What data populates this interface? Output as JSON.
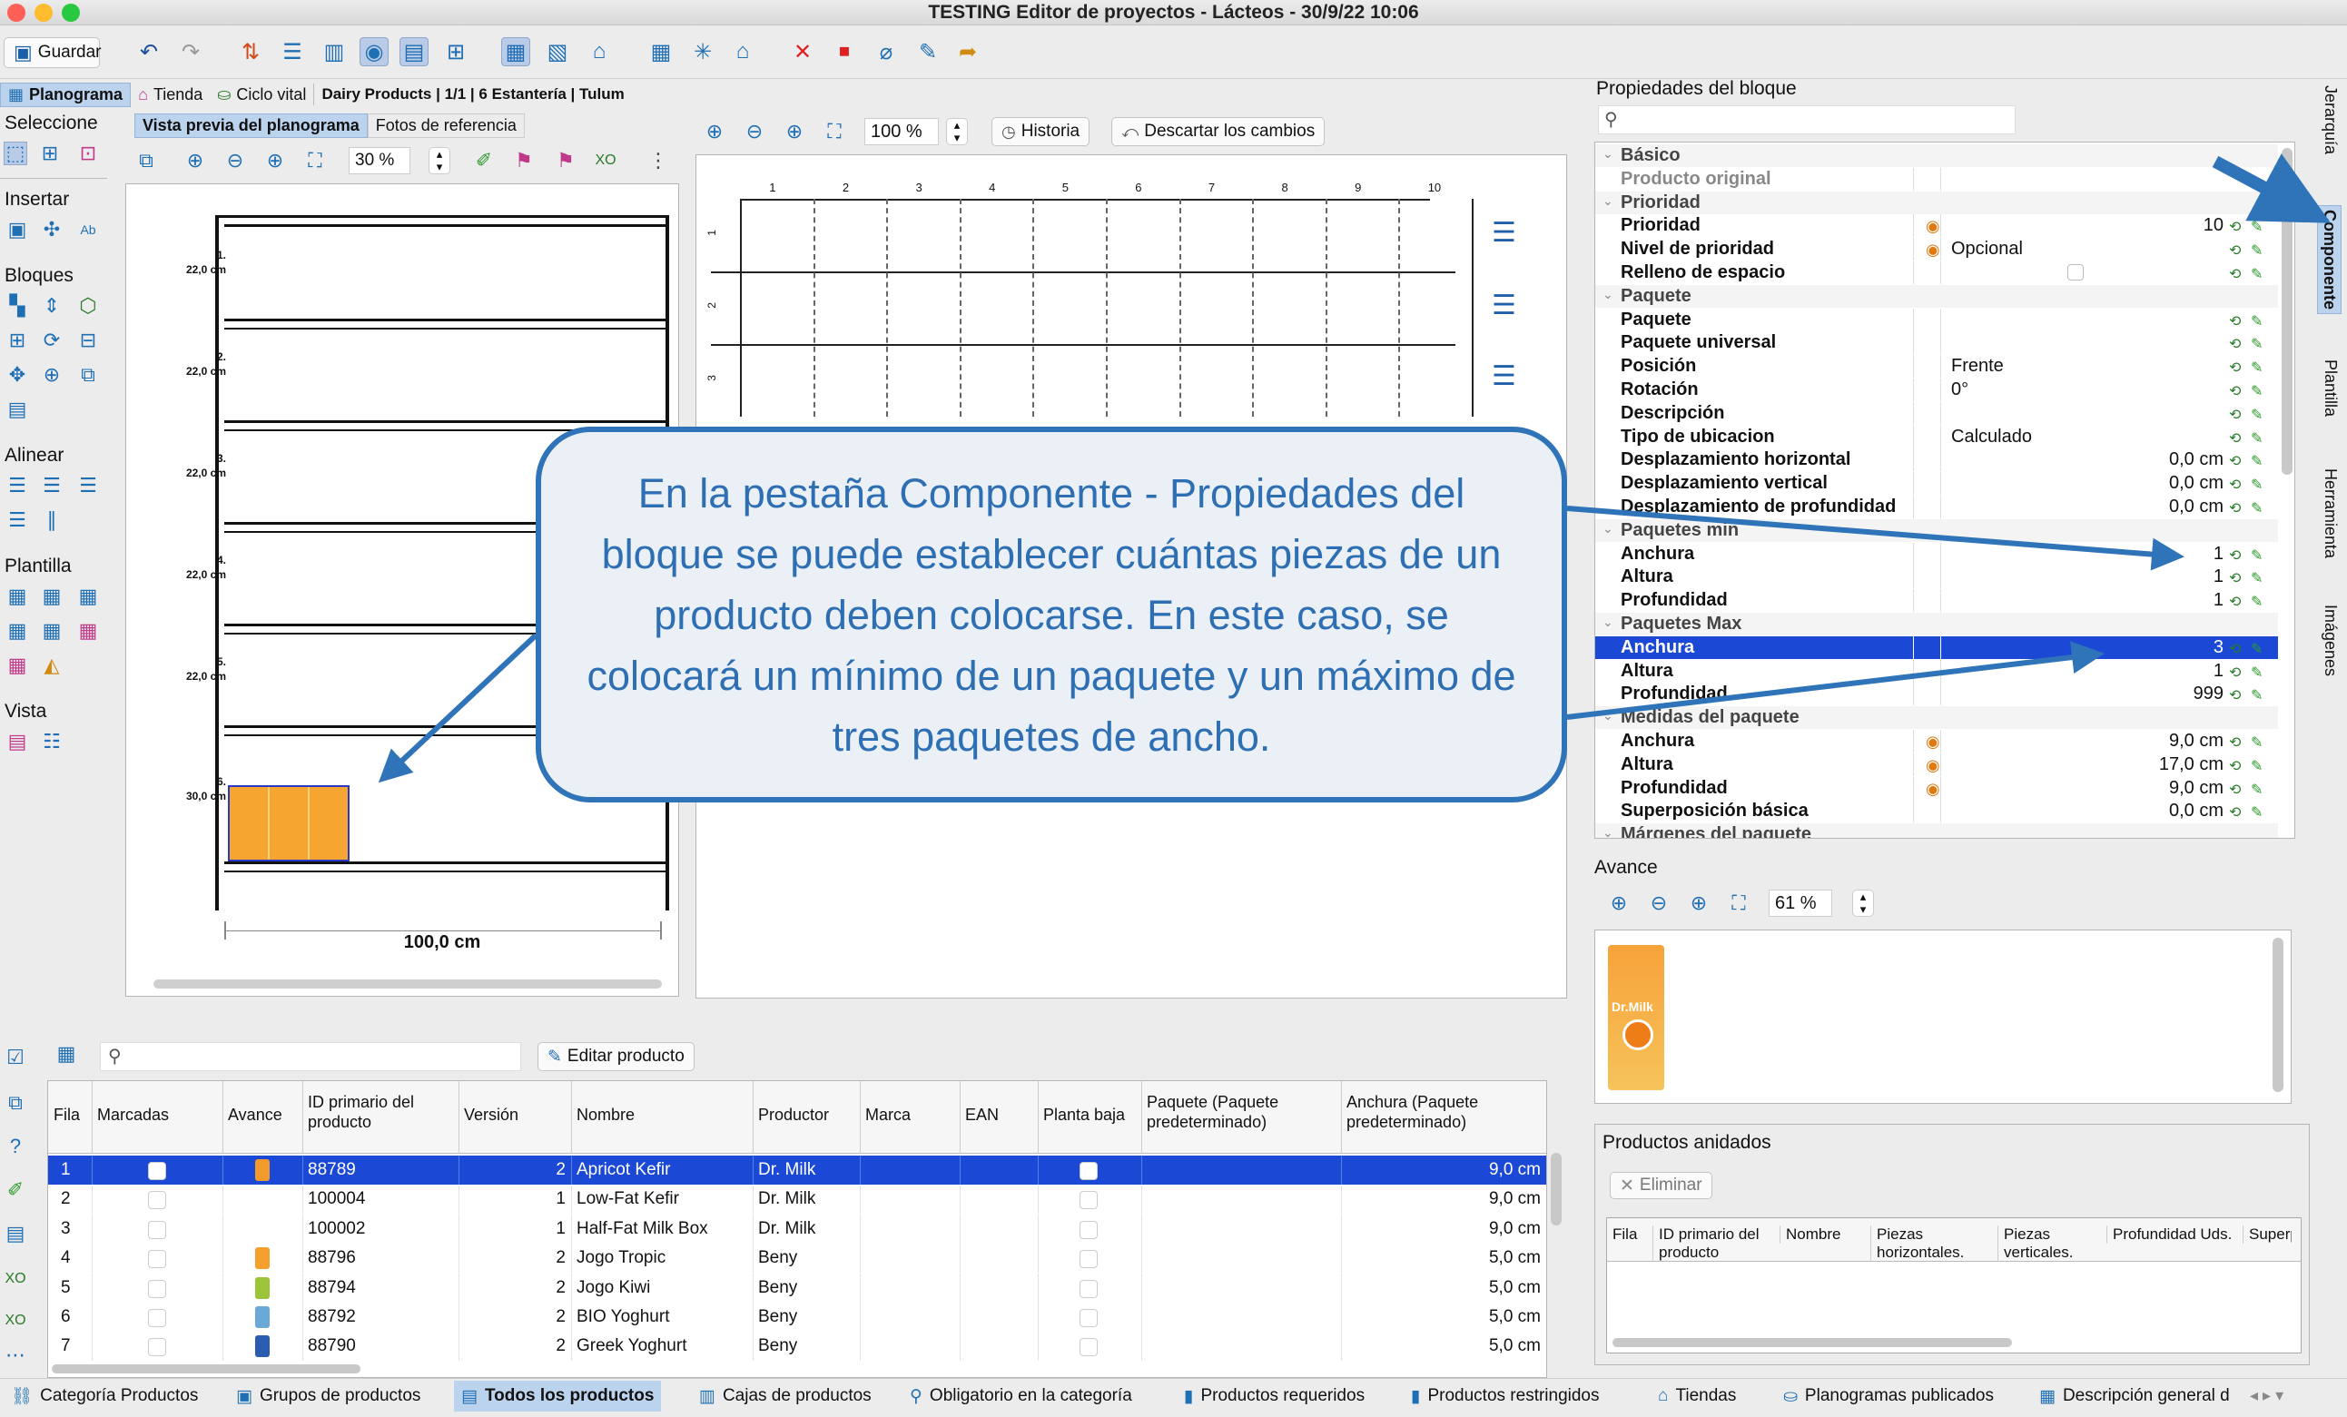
{
  "window": {
    "title": "TESTING Editor de proyectos - Lácteos - 30/9/22 10:06"
  },
  "toolbar": {
    "save_label": "Guardar"
  },
  "nav_tabs": {
    "planograma": "Planograma",
    "tienda": "Tienda",
    "ciclo": "Ciclo vital",
    "path": "Dairy Products | 1/1 | 6 Estantería | Tulum"
  },
  "left_sections": {
    "seleccione": "Seleccione",
    "insertar": "Insertar",
    "bloques": "Bloques",
    "alinear": "Alinear",
    "plantilla": "Plantilla",
    "vista": "Vista"
  },
  "preview": {
    "tab_preview": "Vista previa del planograma",
    "tab_photos": "Fotos de referencia",
    "zoom": "30 %",
    "width_label": "100,0 cm",
    "shelves": [
      {
        "num": "1.",
        "height": "22,0 cm"
      },
      {
        "num": "2.",
        "height": "22,0 cm"
      },
      {
        "num": "3.",
        "height": "22,0 cm"
      },
      {
        "num": "4.",
        "height": "22,0 cm"
      },
      {
        "num": "5.",
        "height": "22,0 cm"
      },
      {
        "num": "6.",
        "height": "30,0 cm"
      }
    ]
  },
  "editor": {
    "zoom": "100 %",
    "history": "Historia",
    "discard": "Descartar los cambios",
    "cols": [
      "1",
      "2",
      "3",
      "4",
      "5",
      "6",
      "7",
      "8",
      "9",
      "10"
    ],
    "rows": [
      "1",
      "2",
      "3"
    ]
  },
  "callout": {
    "text": "En la pestaña Componente - Propiedades del bloque se puede establecer cuántas piezas de un producto deben colocarse. En este caso, se colocará un mínimo de un paquete y un máximo de tres paquetes de ancho."
  },
  "properties": {
    "title": "Propiedades del bloque",
    "rows": [
      {
        "k": "Básico",
        "group": true
      },
      {
        "k": "Producto original",
        "muted": true
      },
      {
        "k": "Prioridad",
        "group": true
      },
      {
        "k": "Prioridad",
        "num": "10",
        "coin": true
      },
      {
        "k": "Nivel de prioridad",
        "v": "Opcional",
        "coin": true
      },
      {
        "k": "Relleno de espacio",
        "check": true
      },
      {
        "k": "Paquete",
        "group": true
      },
      {
        "k": "Paquete"
      },
      {
        "k": "Paquete universal"
      },
      {
        "k": "Posición",
        "v": "Frente"
      },
      {
        "k": "Rotación",
        "v": "0°"
      },
      {
        "k": "Descripción"
      },
      {
        "k": "Tipo de ubicacion",
        "v": "Calculado"
      },
      {
        "k": "Desplazamiento horizontal",
        "num": "0,0 cm"
      },
      {
        "k": "Desplazamiento vertical",
        "num": "0,0 cm"
      },
      {
        "k": "Desplazamiento de profundidad",
        "num": "0,0 cm"
      },
      {
        "k": "Paquetes min",
        "group": true
      },
      {
        "k": "Anchura",
        "num": "1"
      },
      {
        "k": "Altura",
        "num": "1"
      },
      {
        "k": "Profundidad",
        "num": "1"
      },
      {
        "k": "Paquetes Max",
        "group": true
      },
      {
        "k": "Anchura",
        "num": "3",
        "selected": true
      },
      {
        "k": "Altura",
        "num": "1"
      },
      {
        "k": "Profundidad",
        "num": "999"
      },
      {
        "k": "Medidas del paquete",
        "group": true
      },
      {
        "k": "Anchura",
        "num": "9,0 cm",
        "coin": true
      },
      {
        "k": "Altura",
        "num": "17,0 cm",
        "coin": true
      },
      {
        "k": "Profundidad",
        "num": "9,0 cm",
        "coin": true
      },
      {
        "k": "Superposición básica",
        "num": "0,0 cm"
      },
      {
        "k": "Márgenes del paquete",
        "group": true
      }
    ]
  },
  "side_tabs": {
    "jerarquia": "Jerarquía",
    "componente": "Componente",
    "plantilla": "Plantilla",
    "herramienta": "Herramienta",
    "imagenes": "Imágenes"
  },
  "avance": {
    "title": "Avance",
    "zoom": "61 %",
    "brand": "Dr.Milk"
  },
  "nested": {
    "title": "Productos anidados",
    "delete": "Eliminar",
    "cols": [
      "Fila",
      "ID primario del producto",
      "Nombre",
      "Piezas horizontales.",
      "Piezas verticales.",
      "Profundidad Uds.",
      "Superp"
    ]
  },
  "products": {
    "edit_label": "Editar producto",
    "cols": [
      "Fila",
      "Marcadas",
      "Avance",
      "ID primario del producto",
      "Versión",
      "Nombre",
      "Productor",
      "Marca",
      "EAN",
      "Planta baja",
      "Paquete (Paquete predeterminado)",
      "Anchura (Paquete predeterminado)"
    ],
    "rows": [
      {
        "fila": "1",
        "id": "88789",
        "ver": "2",
        "name": "Apricot Kefir",
        "prod": "Dr. Milk",
        "w": "9,0 cm",
        "color": "#f39a2c"
      },
      {
        "fila": "2",
        "id": "100004",
        "ver": "1",
        "name": "Low-Fat Kefir",
        "prod": "Dr. Milk",
        "w": "9,0 cm",
        "color": ""
      },
      {
        "fila": "3",
        "id": "100002",
        "ver": "1",
        "name": "Half-Fat Milk Box",
        "prod": "Dr. Milk",
        "w": "9,0 cm",
        "color": ""
      },
      {
        "fila": "4",
        "id": "88796",
        "ver": "2",
        "name": "Jogo Tropic",
        "prod": "Beny",
        "w": "5,0 cm",
        "color": "#f3a02c"
      },
      {
        "fila": "5",
        "id": "88794",
        "ver": "2",
        "name": "Jogo Kiwi",
        "prod": "Beny",
        "w": "5,0 cm",
        "color": "#9bc43a"
      },
      {
        "fila": "6",
        "id": "88792",
        "ver": "2",
        "name": "BIO Yoghurt",
        "prod": "Beny",
        "w": "5,0 cm",
        "color": "#6aa8d8"
      },
      {
        "fila": "7",
        "id": "88790",
        "ver": "2",
        "name": "Greek Yoghurt",
        "prod": "Beny",
        "w": "5,0 cm",
        "color": "#2a5db0"
      }
    ]
  },
  "bottom_tabs": [
    {
      "label": "Categoría Productos",
      "icon": "⛓"
    },
    {
      "label": "Grupos de productos",
      "icon": "▣"
    },
    {
      "label": "Todos los productos",
      "icon": "▤",
      "sel": true
    },
    {
      "label": "Cajas de productos",
      "icon": "▥"
    },
    {
      "label": "Obligatorio en la categoría",
      "icon": "⚲"
    },
    {
      "label": "Productos requeridos",
      "icon": "▮"
    },
    {
      "label": "Productos restringidos",
      "icon": "▮"
    },
    {
      "label": "Tiendas",
      "icon": "⌂"
    },
    {
      "label": "Planogramas publicados",
      "icon": "⛀"
    },
    {
      "label": "Descripción general d",
      "icon": "▦"
    }
  ]
}
